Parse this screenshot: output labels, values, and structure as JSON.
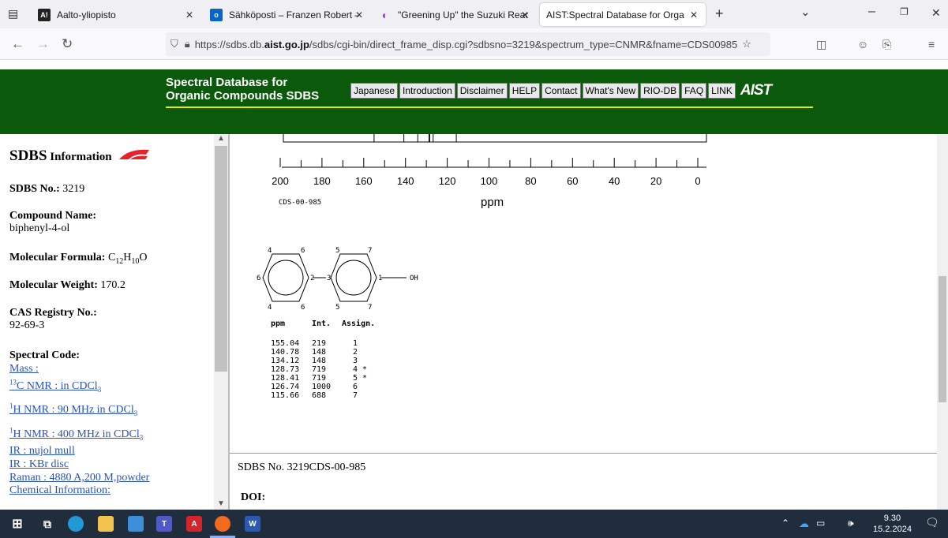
{
  "browser": {
    "tabs": [
      {
        "label": "Aalto-yliopisto",
        "icon": "aalto-icon"
      },
      {
        "label": "Sähköposti – Franzen Robert – (",
        "icon": "outlook-icon"
      },
      {
        "label": "\"Greening Up\" the Suzuki React",
        "icon": "loading-icon"
      },
      {
        "label": "AIST:Spectral Database for Organic",
        "icon": "none"
      }
    ],
    "url_prefix": "https://sdbs.db.",
    "url_host": "aist.go.jp",
    "url_rest": "/sdbs/cgi-bin/direct_frame_disp.cgi?sdbsno=3219&spectrum_type=CNMR&fname=CDS00985"
  },
  "site": {
    "title_line1": "Spectral Database for",
    "title_line2": "Organic Compounds SDBS",
    "menu": [
      "Japanese",
      "Introduction",
      "Disclaimer",
      "HELP",
      "Contact",
      "What's New",
      "RIO-DB",
      "FAQ",
      "LINK"
    ],
    "logo": "AIST"
  },
  "sidebar": {
    "heading_bold": "SDBS",
    "heading_rest": " Information",
    "sdbs_no_label": "SDBS No.:",
    "sdbs_no": " 3219",
    "compound_label": "Compound Name:",
    "compound_name": "biphenyl-4-ol",
    "formula_label": "Molecular Formula:",
    "weight_label": "Molecular Weight:",
    "weight": " 170.2",
    "cas_label": "CAS Registry No.:",
    "cas": "92-69-3",
    "spectral_label": "Spectral Code:",
    "mass": "Mass :",
    "cnmr": "C NMR : in CDCl",
    "hnmr90": "H NMR : 90 MHz in CDCl",
    "hnmr400": "H NMR : 400 MHz in CDCl",
    "ir1": "IR : nujol mull",
    "ir2": "IR : KBr disc",
    "raman": "Raman : 4880 A,200 M,powder",
    "chem_info": "Chemical Information:"
  },
  "spectrum": {
    "axis_ticks": [
      "200",
      "180",
      "160",
      "140",
      "120",
      "100",
      "80",
      "60",
      "40",
      "20",
      "0"
    ],
    "code": "CDS-00-985",
    "unit": "ppm",
    "peaks_ppm": [
      155.04,
      140.78,
      134.12,
      128.73,
      128.41,
      126.74,
      115.66
    ]
  },
  "structure": {
    "labels": [
      "4",
      "6",
      "6",
      "4",
      "6",
      "2",
      "3",
      "5",
      "7",
      "5",
      "7",
      "1",
      "OH"
    ]
  },
  "table": {
    "headers": [
      "ppm",
      "Int.",
      "Assign."
    ],
    "rows": [
      [
        "155.04",
        "219",
        "1"
      ],
      [
        "140.78",
        "148",
        "2"
      ],
      [
        "134.12",
        "148",
        "3"
      ],
      [
        "128.73",
        "719",
        "4 *"
      ],
      [
        "128.41",
        "719",
        "5 *"
      ],
      [
        "126.74",
        "1000",
        "6"
      ],
      [
        "115.66",
        "688",
        "7"
      ]
    ]
  },
  "footer": {
    "sdbs_line": "SDBS No. 3219CDS-00-985",
    "doi_label": "DOI:"
  },
  "taskbar": {
    "time": "9.30",
    "date": "15.2.2024"
  }
}
